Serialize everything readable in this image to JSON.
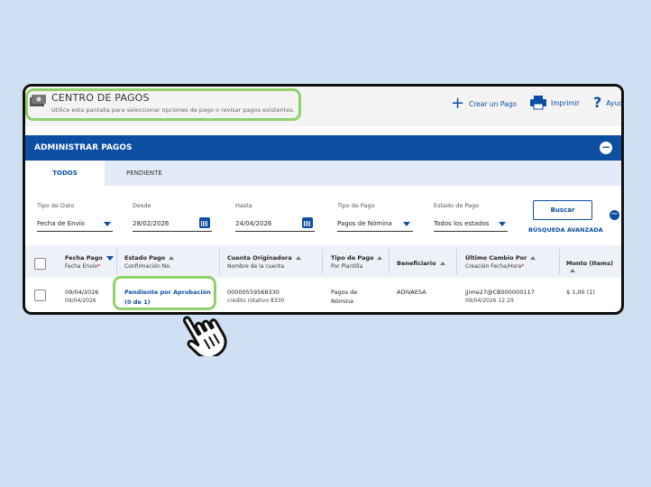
{
  "header": {
    "title": "CENTRO DE PAGOS",
    "subtitle": "Utilice esta pantalla para seleccionar opciones de pago o revisar pagos existentes.",
    "actions": [
      {
        "icon": "plus-icon",
        "label": "Crear un Pago"
      },
      {
        "icon": "printer-icon",
        "label": "Imprimir"
      },
      {
        "icon": "question-icon",
        "label": "Ayuda"
      }
    ]
  },
  "section": {
    "title": "ADMINISTRAR PAGOS"
  },
  "tabs": [
    {
      "label": "TODOS",
      "active": true
    },
    {
      "label": "PENDIENTE",
      "active": false
    }
  ],
  "filters": {
    "tipo_dato": {
      "label": "Tipo de Dato",
      "value": "Fecha de Envío"
    },
    "desde": {
      "label": "Desde",
      "value": "28/02/2026"
    },
    "hasta": {
      "label": "Hasta",
      "value": "24/04/2026"
    },
    "tipo_pago": {
      "label": "Tipo de Pago",
      "value": "Pagos de Nómina"
    },
    "estado_pago": {
      "label": "Estado de Pago",
      "value": "Todos los estados"
    },
    "buscar_label": "Buscar",
    "advanced_label": "BÚSQUEDA AVANZADA"
  },
  "table": {
    "columns": [
      {
        "title": "Fecha Pago",
        "sub": "Fecha Envío",
        "sub_required": true
      },
      {
        "title": "Estado Pago",
        "sub": "Confirmación No."
      },
      {
        "title": "Cuenta Originadora",
        "sub": "Nombre de la cuenta"
      },
      {
        "title": "Tipo de Pago",
        "sub": "Por Plantilla"
      },
      {
        "title": "Beneficiario",
        "sub": ""
      },
      {
        "title": "Último Cambio Por",
        "sub": "Creación Fecha/Hora",
        "sub_required": true
      },
      {
        "title": "Monto (Items)",
        "sub": ""
      }
    ],
    "rows": [
      {
        "fecha_pago": "09/04/2026",
        "fecha_envio": "09/04/2026",
        "estado": "Pendiente por Aprobación (0 de 1)",
        "cuenta": "00000559568330",
        "cuenta_nombre": "credito rotativo 8330",
        "tipo": "Pagos de Nómina",
        "beneficiario": "ADIVAESA",
        "ultimo_cambio": "jjime27@CB000000117",
        "creacion": "09/04/2026 12:29",
        "monto": "$ 1,00 (1)"
      }
    ]
  },
  "colors": {
    "brand": "#0b4ea2",
    "highlight": "#8fd16a",
    "background": "#cfe0f3"
  }
}
